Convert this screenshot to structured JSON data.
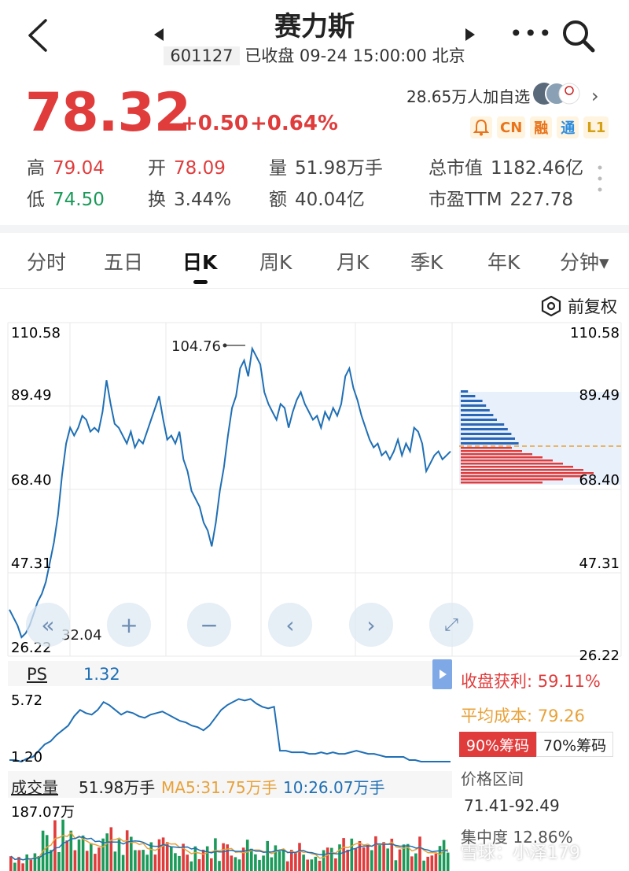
{
  "header": {
    "title": "赛力斯",
    "code": "601127",
    "status": "已收盘 09-24 15:00:00 北京"
  },
  "quote": {
    "price": "78.32",
    "change": "+0.50",
    "change_pct": "+0.64%",
    "followers": "28.65万人加自选",
    "badges": [
      {
        "label": "CN",
        "color": "#e8741c"
      },
      {
        "label": "融",
        "color": "#e8741c"
      },
      {
        "label": "通",
        "color": "#2b8ce0"
      },
      {
        "label": "L1",
        "color": "#d4a014"
      }
    ],
    "stats": {
      "high_label": "高",
      "high": "79.04",
      "open_label": "开",
      "open": "78.09",
      "volume_label": "量",
      "volume": "51.98万手",
      "mktcap_label": "总市值",
      "mktcap": "1182.46亿",
      "low_label": "低",
      "low": "74.50",
      "turnover_label": "换",
      "turnover": "3.44%",
      "amount_label": "额",
      "amount": "40.04亿",
      "pe_label": "市盈TTM",
      "pe": "227.78"
    }
  },
  "tabs": [
    "分时",
    "五日",
    "日K",
    "周K",
    "月K",
    "季K",
    "年K",
    "分钟▾"
  ],
  "active_tab": "日K",
  "adjust_label": "前复权",
  "chart_data": {
    "type": "line",
    "title": "",
    "y_ticks": [
      "110.58",
      "89.49",
      "68.40",
      "47.31",
      "26.22"
    ],
    "ylim": [
      26.22,
      110.58
    ],
    "max_label": "104.76",
    "min_label": "32.04",
    "series": [
      {
        "values": [
          38,
          36,
          34,
          31,
          32,
          34,
          37,
          40,
          42,
          45,
          50,
          55,
          62,
          72,
          80,
          84,
          82,
          84,
          87,
          86,
          83,
          84,
          83,
          88,
          96,
          90,
          85,
          84,
          82,
          80,
          83,
          79,
          81,
          80,
          83,
          86,
          89,
          92,
          86,
          81,
          82,
          80,
          83,
          76,
          73,
          68,
          66,
          64,
          60,
          58,
          54,
          60,
          68,
          74,
          82,
          89,
          92,
          99,
          101,
          97,
          104,
          102,
          100,
          93,
          90,
          88,
          86,
          90,
          89,
          84,
          88,
          91,
          93,
          90,
          88,
          86,
          87,
          84,
          88,
          86,
          89,
          87,
          90,
          97,
          99,
          94,
          91,
          87,
          84,
          81,
          79,
          80,
          77,
          78,
          76,
          78,
          81,
          77,
          80,
          78,
          84,
          83,
          80,
          73,
          75,
          77,
          78,
          76,
          77,
          78
        ],
        "color": "#1f6fb5"
      }
    ],
    "profile": {
      "profit_bars": [
        2,
        4,
        6,
        7,
        8,
        9,
        10,
        12,
        13,
        14,
        15,
        16
      ],
      "loss_bars": [
        5,
        6,
        7,
        8,
        9,
        10,
        11,
        12,
        13,
        12,
        10,
        8
      ]
    },
    "ps": {
      "label": "PS",
      "value": "1.32",
      "top": "5.72",
      "bottom": "1.20",
      "values": [
        1.4,
        1.4,
        1.3,
        1.5,
        1.6,
        2.0,
        2.4,
        2.6,
        3.0,
        3.3,
        3.6,
        4.2,
        4.6,
        4.4,
        4.3,
        4.6,
        5.1,
        4.9,
        4.6,
        4.3,
        4.5,
        4.4,
        4.2,
        4.1,
        4.3,
        4.4,
        4.5,
        4.3,
        4.1,
        3.9,
        3.8,
        3.6,
        3.5,
        3.3,
        3.6,
        4.1,
        4.6,
        4.9,
        5.1,
        5.3,
        5.2,
        5.3,
        5.0,
        4.8,
        4.7,
        4.8,
        2.0,
        2.0,
        1.9,
        1.9,
        1.9,
        1.8,
        1.8,
        1.9,
        1.8,
        1.9,
        1.8,
        1.8,
        1.9,
        2.0,
        1.9,
        1.8,
        1.8,
        1.7,
        1.6,
        1.6,
        1.6,
        1.6,
        1.4,
        1.4,
        1.3,
        1.3,
        1.3,
        1.3,
        1.3,
        1.3
      ]
    },
    "volume": {
      "label": "成交量",
      "last": "51.98万手",
      "ma5": "MA5:31.75万手",
      "ma10": "10:26.07万手",
      "top": "187.07万"
    }
  },
  "cost": {
    "profit_label": "收盘获利:",
    "profit_value": "59.11%",
    "avg_label": "平均成本:",
    "avg_value": "79.26",
    "chip90": "90%筹码",
    "chip70": "70%筹码",
    "range_label": "价格区间",
    "range_value": "71.41-92.49",
    "conc_label": "集中度",
    "conc_value": "12.86%"
  },
  "watermark": "雪球：小泽179"
}
